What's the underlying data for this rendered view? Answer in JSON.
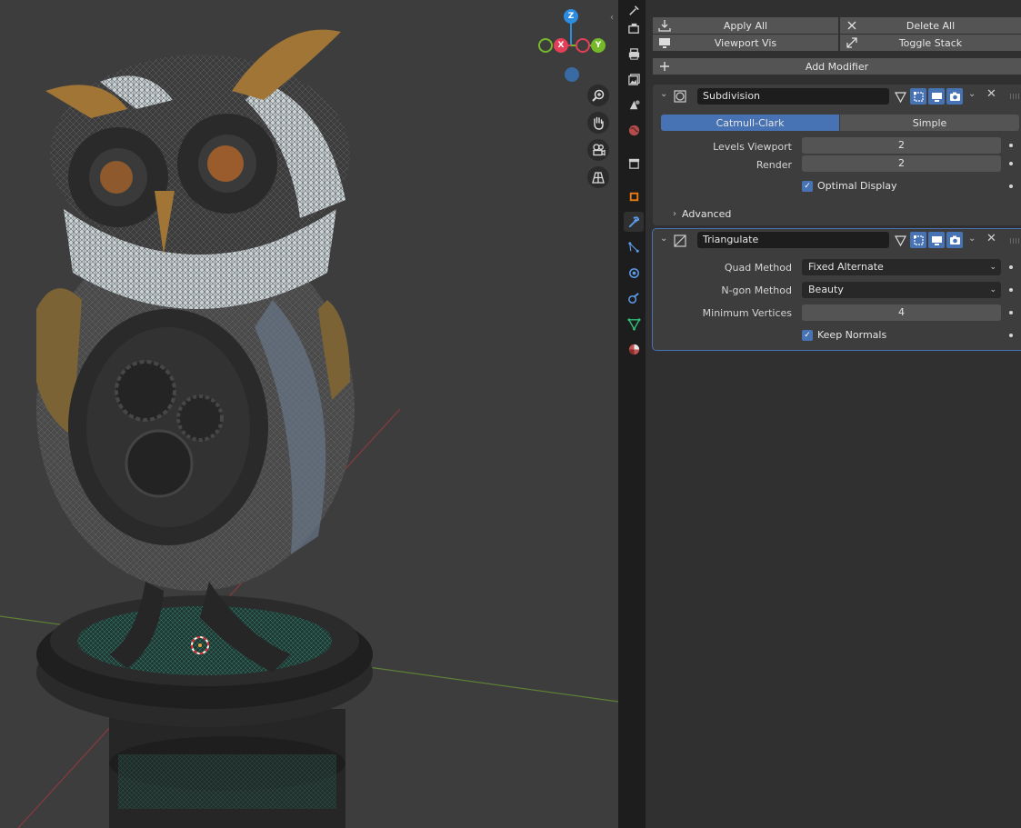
{
  "viewport": {
    "gizmo": {
      "z": "Z",
      "x": "X",
      "y": "Y"
    },
    "nav": {
      "zoom": "zoom-icon",
      "pan": "hand-icon",
      "camera": "camera-icon",
      "ortho": "grid-icon"
    },
    "scroll_up": "‹"
  },
  "tabs": [
    "tool",
    "render",
    "output",
    "view-layer",
    "scene",
    "world",
    "collection",
    "object",
    "modifiers",
    "particles",
    "physics",
    "constraints",
    "data",
    "material"
  ],
  "toolbar": {
    "apply_all": "Apply All",
    "delete_all": "Delete All",
    "viewport_vis": "Viewport Vis",
    "toggle_stack": "Toggle Stack",
    "add_modifier": "Add Modifier"
  },
  "subdivision": {
    "name": "Subdivision",
    "algo_catmull": "Catmull-Clark",
    "algo_simple": "Simple",
    "selected_algo": "Catmull-Clark",
    "levels_viewport_label": "Levels Viewport",
    "levels_viewport": "2",
    "render_label": "Render",
    "render": "2",
    "optimal_display_label": "Optimal Display",
    "optimal_display": true,
    "advanced_label": "Advanced"
  },
  "triangulate": {
    "name": "Triangulate",
    "quad_method_label": "Quad Method",
    "quad_method": "Fixed Alternate",
    "ngon_method_label": "N-gon Method",
    "ngon_method": "Beauty",
    "min_vertices_label": "Minimum Vertices",
    "min_vertices": "4",
    "keep_normals_label": "Keep Normals",
    "keep_normals": true
  },
  "colors": {
    "accent": "#4772b3",
    "panel_bg": "#303030",
    "viewport_bg": "#3d3d3d",
    "x_axis": "#e53f58",
    "y_axis": "#75b82a",
    "z_axis": "#2c8ce0"
  }
}
